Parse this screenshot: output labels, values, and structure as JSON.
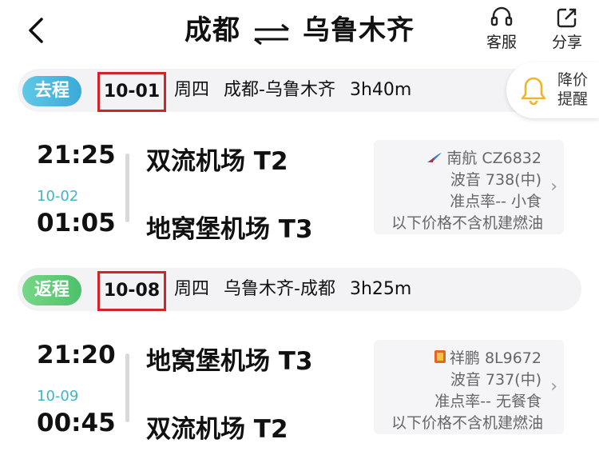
{
  "header": {
    "from": "成都",
    "to": "乌鲁木齐",
    "service_label": "客服",
    "share_label": "分享"
  },
  "price_alert": {
    "label": "降价提醒"
  },
  "outbound": {
    "tag": "去程",
    "date": "10-01",
    "weekday": "周四",
    "route": "成都-乌鲁木齐",
    "duration": "3h40m",
    "depart_time": "21:25",
    "arrive_date": "10-02",
    "arrive_time": "01:05",
    "depart_airport": "双流机场 T2",
    "arrive_airport": "地窝堡机场 T3",
    "airline": "南航 CZ6832",
    "aircraft": "波音 738(中)",
    "ontime": "准点率-- 小食",
    "price_note": "以下价格不含机建燃油"
  },
  "return": {
    "tag": "返程",
    "date": "10-08",
    "weekday": "周四",
    "route": "乌鲁木齐-成都",
    "duration": "3h25m",
    "depart_time": "21:20",
    "arrive_date": "10-09",
    "arrive_time": "00:45",
    "depart_airport": "地窝堡机场 T3",
    "arrive_airport": "双流机场 T2",
    "airline": "祥鹏 8L9672",
    "aircraft": "波音 737(中)",
    "ontime": "准点率-- 无餐食",
    "price_note": "以下价格不含机建燃油"
  },
  "colors": {
    "outbound_tag": "#3aa9d8",
    "return_tag": "#4cc06a",
    "highlight_box": "#d0242b",
    "next_day": "#43b3c7",
    "bell": "#f0b429"
  },
  "icons": {
    "back": "chevron-left-icon",
    "swap": "swap-arrows-icon",
    "service": "headset-icon",
    "share": "share-icon",
    "bell": "bell-icon"
  }
}
